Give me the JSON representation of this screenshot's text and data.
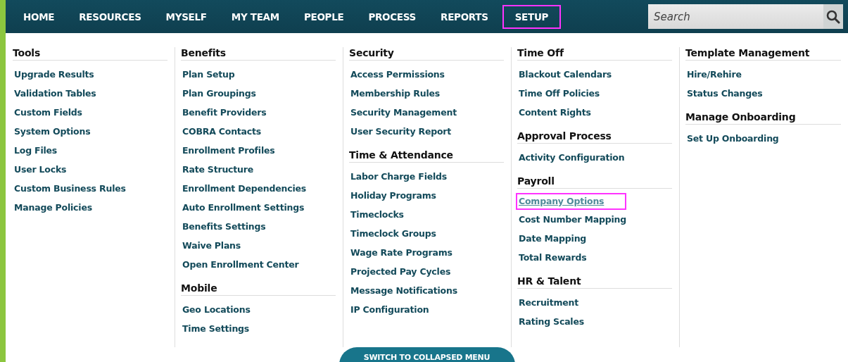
{
  "nav": [
    {
      "label": "HOME",
      "selected": false
    },
    {
      "label": "RESOURCES",
      "selected": false
    },
    {
      "label": "MYSELF",
      "selected": false
    },
    {
      "label": "MY TEAM",
      "selected": false
    },
    {
      "label": "PEOPLE",
      "selected": false
    },
    {
      "label": "PROCESS",
      "selected": false
    },
    {
      "label": "REPORTS",
      "selected": false
    },
    {
      "label": "SETUP",
      "selected": true
    }
  ],
  "search": {
    "placeholder": "Search"
  },
  "columns": [
    {
      "sections": [
        {
          "title": "Tools",
          "links": [
            {
              "label": "Upgrade Results",
              "highlighted": false
            },
            {
              "label": "Validation Tables",
              "highlighted": false
            },
            {
              "label": "Custom Fields",
              "highlighted": false
            },
            {
              "label": "System Options",
              "highlighted": false
            },
            {
              "label": "Log Files",
              "highlighted": false
            },
            {
              "label": "User Locks",
              "highlighted": false
            },
            {
              "label": "Custom Business Rules",
              "highlighted": false
            },
            {
              "label": "Manage Policies",
              "highlighted": false
            }
          ]
        }
      ]
    },
    {
      "sections": [
        {
          "title": "Benefits",
          "links": [
            {
              "label": "Plan Setup",
              "highlighted": false
            },
            {
              "label": "Plan Groupings",
              "highlighted": false
            },
            {
              "label": "Benefit Providers",
              "highlighted": false
            },
            {
              "label": "COBRA Contacts",
              "highlighted": false
            },
            {
              "label": "Enrollment Profiles",
              "highlighted": false
            },
            {
              "label": "Rate Structure",
              "highlighted": false
            },
            {
              "label": "Enrollment Dependencies",
              "highlighted": false
            },
            {
              "label": "Auto Enrollment Settings",
              "highlighted": false
            },
            {
              "label": "Benefits Settings",
              "highlighted": false
            },
            {
              "label": "Waive Plans",
              "highlighted": false
            },
            {
              "label": "Open Enrollment Center",
              "highlighted": false
            }
          ]
        },
        {
          "title": "Mobile",
          "links": [
            {
              "label": "Geo Locations",
              "highlighted": false
            },
            {
              "label": "Time Settings",
              "highlighted": false
            }
          ]
        }
      ]
    },
    {
      "sections": [
        {
          "title": "Security",
          "links": [
            {
              "label": "Access Permissions",
              "highlighted": false
            },
            {
              "label": "Membership Rules",
              "highlighted": false
            },
            {
              "label": "Security Management",
              "highlighted": false
            },
            {
              "label": "User Security Report",
              "highlighted": false
            }
          ]
        },
        {
          "title": "Time & Attendance",
          "links": [
            {
              "label": "Labor Charge Fields",
              "highlighted": false
            },
            {
              "label": "Holiday Programs",
              "highlighted": false
            },
            {
              "label": "Timeclocks",
              "highlighted": false
            },
            {
              "label": "Timeclock Groups",
              "highlighted": false
            },
            {
              "label": "Wage Rate Programs",
              "highlighted": false
            },
            {
              "label": "Projected Pay Cycles",
              "highlighted": false
            },
            {
              "label": "Message Notifications",
              "highlighted": false
            },
            {
              "label": "IP Configuration",
              "highlighted": false
            }
          ]
        }
      ]
    },
    {
      "sections": [
        {
          "title": "Time Off",
          "links": [
            {
              "label": "Blackout Calendars",
              "highlighted": false
            },
            {
              "label": "Time Off Policies",
              "highlighted": false
            },
            {
              "label": "Content Rights",
              "highlighted": false
            }
          ]
        },
        {
          "title": "Approval Process",
          "links": [
            {
              "label": "Activity Configuration",
              "highlighted": false
            }
          ]
        },
        {
          "title": "Payroll",
          "links": [
            {
              "label": "Company Options",
              "highlighted": true
            },
            {
              "label": "Cost Number Mapping",
              "highlighted": false
            },
            {
              "label": "Date Mapping",
              "highlighted": false
            },
            {
              "label": "Total Rewards",
              "highlighted": false
            }
          ]
        },
        {
          "title": "HR & Talent",
          "links": [
            {
              "label": "Recruitment",
              "highlighted": false
            },
            {
              "label": "Rating Scales",
              "highlighted": false
            }
          ]
        }
      ]
    },
    {
      "sections": [
        {
          "title": "Template Management",
          "links": [
            {
              "label": "Hire/Rehire",
              "highlighted": false
            },
            {
              "label": "Status Changes",
              "highlighted": false
            }
          ]
        },
        {
          "title": "Manage Onboarding",
          "links": [
            {
              "label": "Set Up Onboarding",
              "highlighted": false
            }
          ]
        }
      ]
    }
  ],
  "collapse_button": "SWITCH TO COLLAPSED MENU"
}
